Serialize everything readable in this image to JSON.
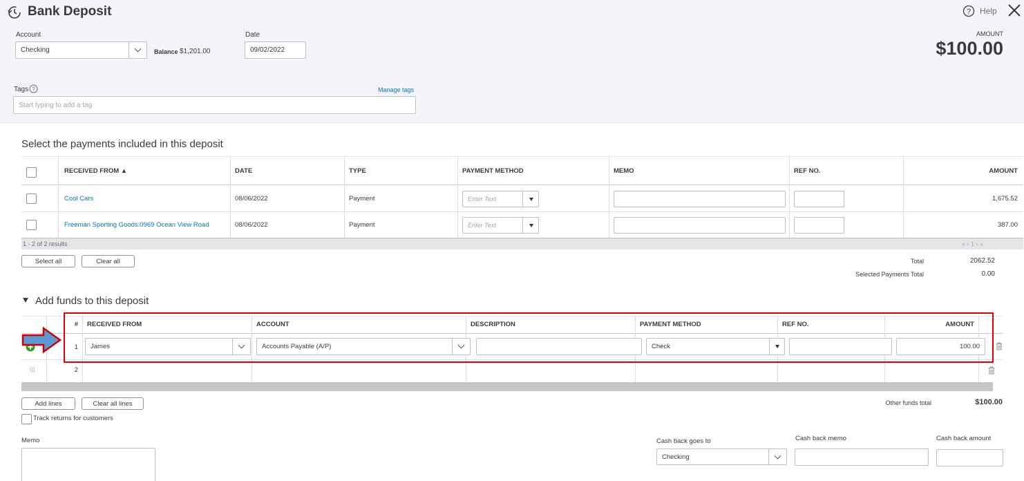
{
  "header": {
    "title": "Bank Deposit",
    "help_label": "Help",
    "account_label": "Account",
    "account_value": "Checking",
    "balance_label": "Balance",
    "balance_value": "$1,201.00",
    "date_label": "Date",
    "date_value": "09/02/2022",
    "amount_label": "AMOUNT",
    "amount_value": "$100.00",
    "tags_label": "Tags",
    "manage_tags": "Manage tags",
    "tags_placeholder": "Start typing to add a tag"
  },
  "payments": {
    "section_title": "Select the payments included in this deposit",
    "columns": [
      "RECEIVED FROM ▲",
      "DATE",
      "TYPE",
      "PAYMENT METHOD",
      "MEMO",
      "REF NO.",
      "AMOUNT"
    ],
    "rows": [
      {
        "received_from": "Cool Cars",
        "date": "08/06/2022",
        "type": "Payment",
        "method_placeholder": "Enter Text",
        "amount": "1,675.52"
      },
      {
        "received_from": "Freeman Sporting Goods:0969 Ocean View Road",
        "date": "08/06/2022",
        "type": "Payment",
        "method_placeholder": "Enter Text",
        "amount": "387.00"
      }
    ],
    "results_text": "1 - 2 of 2 results",
    "pager": "« ‹ 1 › »",
    "select_all": "Select all",
    "clear_all": "Clear all",
    "total_label": "Total",
    "total_value": "2062.52",
    "selected_total_label": "Selected Payments Total",
    "selected_total_value": "0.00"
  },
  "funds": {
    "section_title": "Add funds to this deposit",
    "columns": [
      "#",
      "RECEIVED FROM",
      "ACCOUNT",
      "DESCRIPTION",
      "PAYMENT METHOD",
      "REF NO.",
      "AMOUNT"
    ],
    "rows": [
      {
        "num": "1",
        "received_from": "James",
        "account": "Accounts Payable (A/P)",
        "description": "",
        "method": "Check",
        "ref": "",
        "amount": "100.00"
      },
      {
        "num": "2"
      }
    ],
    "add_lines": "Add lines",
    "clear_all_lines": "Clear all lines",
    "other_funds_label": "Other funds total",
    "other_funds_value": "$100.00",
    "track_returns": "Track returns for customers"
  },
  "footer": {
    "memo_label": "Memo",
    "cash_back_goes_to_label": "Cash back goes to",
    "cash_back_goes_to_value": "Checking",
    "cash_back_memo_label": "Cash back memo",
    "cash_back_amount_label": "Cash back amount"
  },
  "colors": {
    "link": "#0077c5",
    "highlight_box": "#e00000",
    "arrow_fill": "#5b9bd5",
    "arrow_stroke": "#d00000",
    "add_icon": "#2ca01c"
  }
}
